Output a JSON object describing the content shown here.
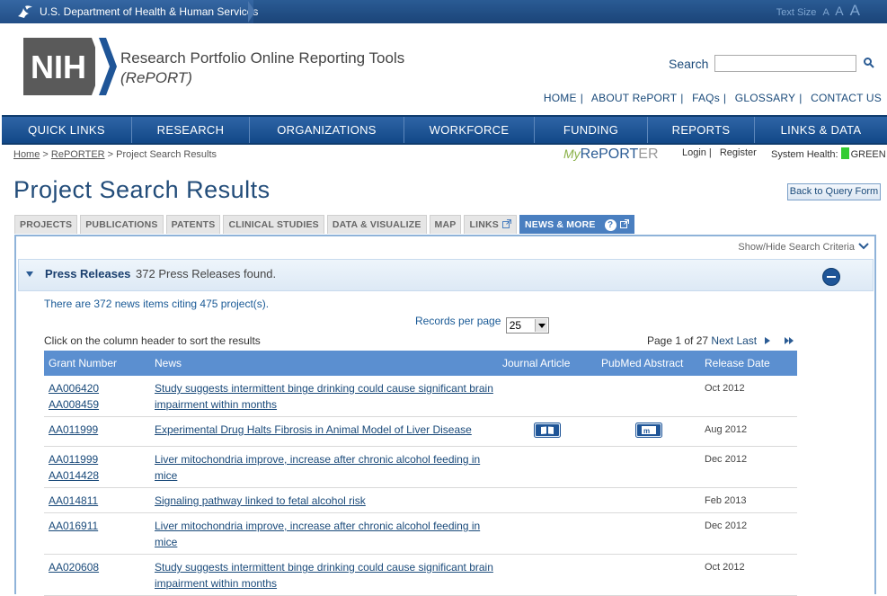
{
  "hhs": {
    "department": "U.S. Department of Health & Human Services",
    "text_size_label": "Text Size",
    "text_size_options": [
      "A",
      "A",
      "A"
    ]
  },
  "header": {
    "logo_text": "NIH",
    "title_line1": "Research Portfolio Online Reporting Tools",
    "title_line2": "(RePORT)",
    "search_label": "Search",
    "search_value": "",
    "top_links": [
      "HOME",
      "ABOUT RePORT",
      "FAQs",
      "GLOSSARY",
      "CONTACT US"
    ]
  },
  "main_nav": [
    "QUICK LINKS",
    "RESEARCH",
    "ORGANIZATIONS",
    "WORKFORCE",
    "FUNDING",
    "REPORTS",
    "LINKS & DATA"
  ],
  "breadcrumb": {
    "items": [
      "Home",
      "RePORTER"
    ],
    "separator": ">",
    "current": "Project Search Results"
  },
  "myreporter": {
    "my": "My",
    "re": "RePORT",
    "er": "ER"
  },
  "account": {
    "login": "Login",
    "register": "Register"
  },
  "system_health": {
    "label": "System Health:",
    "status": "GREEN",
    "color": "#33cc33"
  },
  "page": {
    "title": "Project Search Results",
    "back_button": "Back to Query Form"
  },
  "tabs": [
    {
      "label": "PROJECTS"
    },
    {
      "label": "PUBLICATIONS"
    },
    {
      "label": "PATENTS"
    },
    {
      "label": "CLINICAL STUDIES"
    },
    {
      "label": "DATA & VISUALIZE"
    },
    {
      "label": "MAP"
    },
    {
      "label": "LINKS"
    },
    {
      "label": "NEWS & MORE"
    }
  ],
  "active_tab_index": 7,
  "panel": {
    "show_hide": "Show/Hide Search Criteria",
    "section_title": "Press Releases",
    "section_count": "372 Press Releases found.",
    "summary": "There are 372 news items citing 475 project(s).",
    "records_per_page_label": "Records per page",
    "records_per_page_value": "25",
    "sort_hint": "Click on the column header to sort the results",
    "pager_text": "Page 1 of 27",
    "pager_next": "Next",
    "pager_last": "Last"
  },
  "table": {
    "headers": [
      "Grant Number",
      "News",
      "Journal Article",
      "PubMed Abstract",
      "Release Date"
    ],
    "rows": [
      {
        "grants": [
          "AA006420",
          "AA008459"
        ],
        "news": "Study suggests intermittent binge drinking could cause significant brain impairment within months",
        "journal": false,
        "pubmed": false,
        "date": "Oct 2012"
      },
      {
        "grants": [
          "AA011999"
        ],
        "news": "Experimental Drug Halts Fibrosis in Animal Model of Liver Disease",
        "journal": true,
        "pubmed": true,
        "date": "Aug 2012"
      },
      {
        "grants": [
          "AA011999",
          "AA014428"
        ],
        "news": "Liver mitochondria improve, increase after chronic alcohol feeding in mice",
        "journal": false,
        "pubmed": false,
        "date": "Dec 2012"
      },
      {
        "grants": [
          "AA014811"
        ],
        "news": "Signaling pathway linked to fetal alcohol risk",
        "journal": false,
        "pubmed": false,
        "date": "Feb 2013"
      },
      {
        "grants": [
          "AA016911"
        ],
        "news": "Liver mitochondria improve, increase after chronic alcohol feeding in mice",
        "journal": false,
        "pubmed": false,
        "date": "Dec 2012"
      },
      {
        "grants": [
          "AA020608"
        ],
        "news": "Study suggests intermittent binge drinking could cause significant brain impairment within months",
        "journal": false,
        "pubmed": false,
        "date": "Oct 2012"
      }
    ]
  }
}
